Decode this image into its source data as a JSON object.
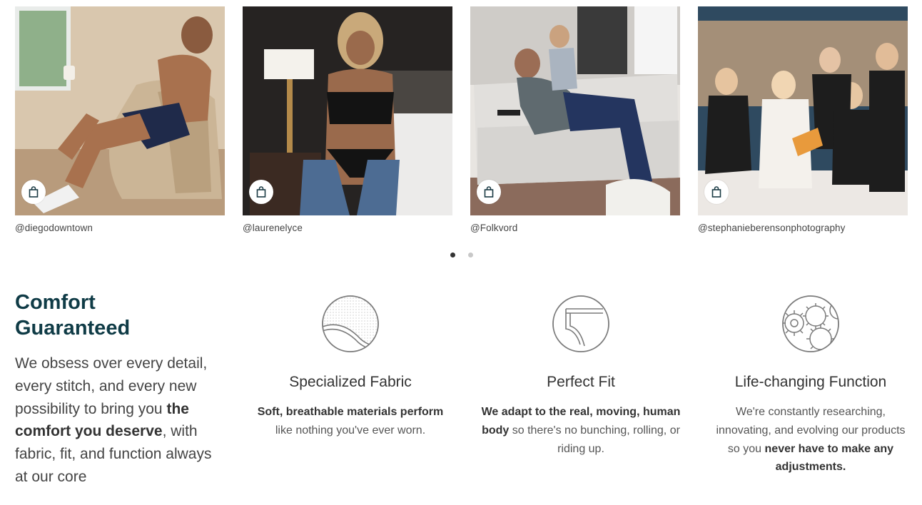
{
  "gallery": {
    "items": [
      {
        "handle": "@diegodowntown"
      },
      {
        "handle": "@laurenelyce"
      },
      {
        "handle": "@Folkvord"
      },
      {
        "handle": "@stephanieberensonphotography"
      }
    ],
    "pagination": {
      "current": 1,
      "total": 2
    }
  },
  "comfort": {
    "title": "Comfort\nGuaranteed",
    "body_1": "We obsess over every detail, every stitch, and every new possibility to bring you ",
    "body_bold": "the comfort you deserve",
    "body_2": ", with fabric, fit, and function always at our core"
  },
  "features": [
    {
      "icon": "fabric-icon",
      "title": "Specialized Fabric",
      "bold_1": "Soft, breathable materials perform",
      "text_1": " like nothing you've ever worn.",
      "bold_2": "",
      "text_2": ""
    },
    {
      "icon": "fit-icon",
      "title": "Perfect Fit",
      "bold_1": "We adapt to the real, moving, human body",
      "text_1": " so there's no bunching, rolling, or riding up.",
      "bold_2": "",
      "text_2": ""
    },
    {
      "icon": "gears-icon",
      "title": "Life-changing Function",
      "bold_1": "",
      "text_1": "We're constantly researching, innovating, and evolving our products so you ",
      "bold_2": "never have to make any adjustments.",
      "text_2": ""
    }
  ],
  "colors": {
    "heading": "#0f3b46",
    "dot_active": "#333333",
    "dot_inactive": "#c8c8c8"
  }
}
